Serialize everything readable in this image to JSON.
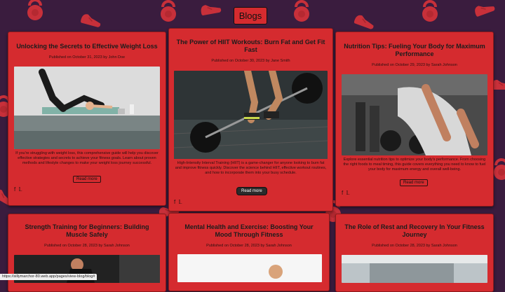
{
  "header": {
    "title": "Blogs"
  },
  "posts": [
    {
      "title": "Unlocking the Secrets to Effective Weight Loss",
      "meta": "Published on October 31, 2023 by John Doe",
      "excerpt": "If you're struggling with weight loss, this comprehensive guide will help you discover effective strategies and secrets to achieve your fitness goals. Learn about proven methods and lifestyle changes to make your weight loss journey successful.",
      "cta": "Read more"
    },
    {
      "title": "The Power of HIIT Workouts: Burn Fat and Get Fit Fast",
      "meta": "Published on October 30, 2023 by Jane Smith",
      "excerpt": "High-Intensity Interval Training (HIIT) is a game-changer for anyone looking to burn fat and improve fitness quickly. Discover the science behind HIIT, effective workout routines, and how to incorporate them into your busy schedule.",
      "cta": "Read more"
    },
    {
      "title": "Nutrition Tips: Fueling Your Body for Maximum Performance",
      "meta": "Published on October 29, 2023 by Sarah Johnson",
      "excerpt": "Explore essential nutrition tips to optimize your body's performance. From choosing the right foods to meal timing, this guide covers everything you need to know to fuel your body for maximum energy and overall well-being.",
      "cta": "Read more"
    },
    {
      "title": "Strength Training for Beginners: Building Muscle Safely",
      "meta": "Published on October 28, 2023 by Sarah Johnson"
    },
    {
      "title": "Mental Health and Exercise: Boosting Your Mood Through Fitness",
      "meta": "Published on October 28, 2023 by Sarah Johnson"
    },
    {
      "title": "The Role of Rest and Recovery In Your Fitness Journey",
      "meta": "Published on October 28, 2023 by Sarah Johnson"
    }
  ],
  "social_icons": [
    "facebook-icon",
    "twitter-icon"
  ],
  "status_bar": {
    "url": "https://sillymarchor-80.web.app/pages/view-blog/blog#"
  },
  "colors": {
    "background": "#3a1c3e",
    "card": "#d52b2f",
    "pattern": "#c8303a"
  }
}
